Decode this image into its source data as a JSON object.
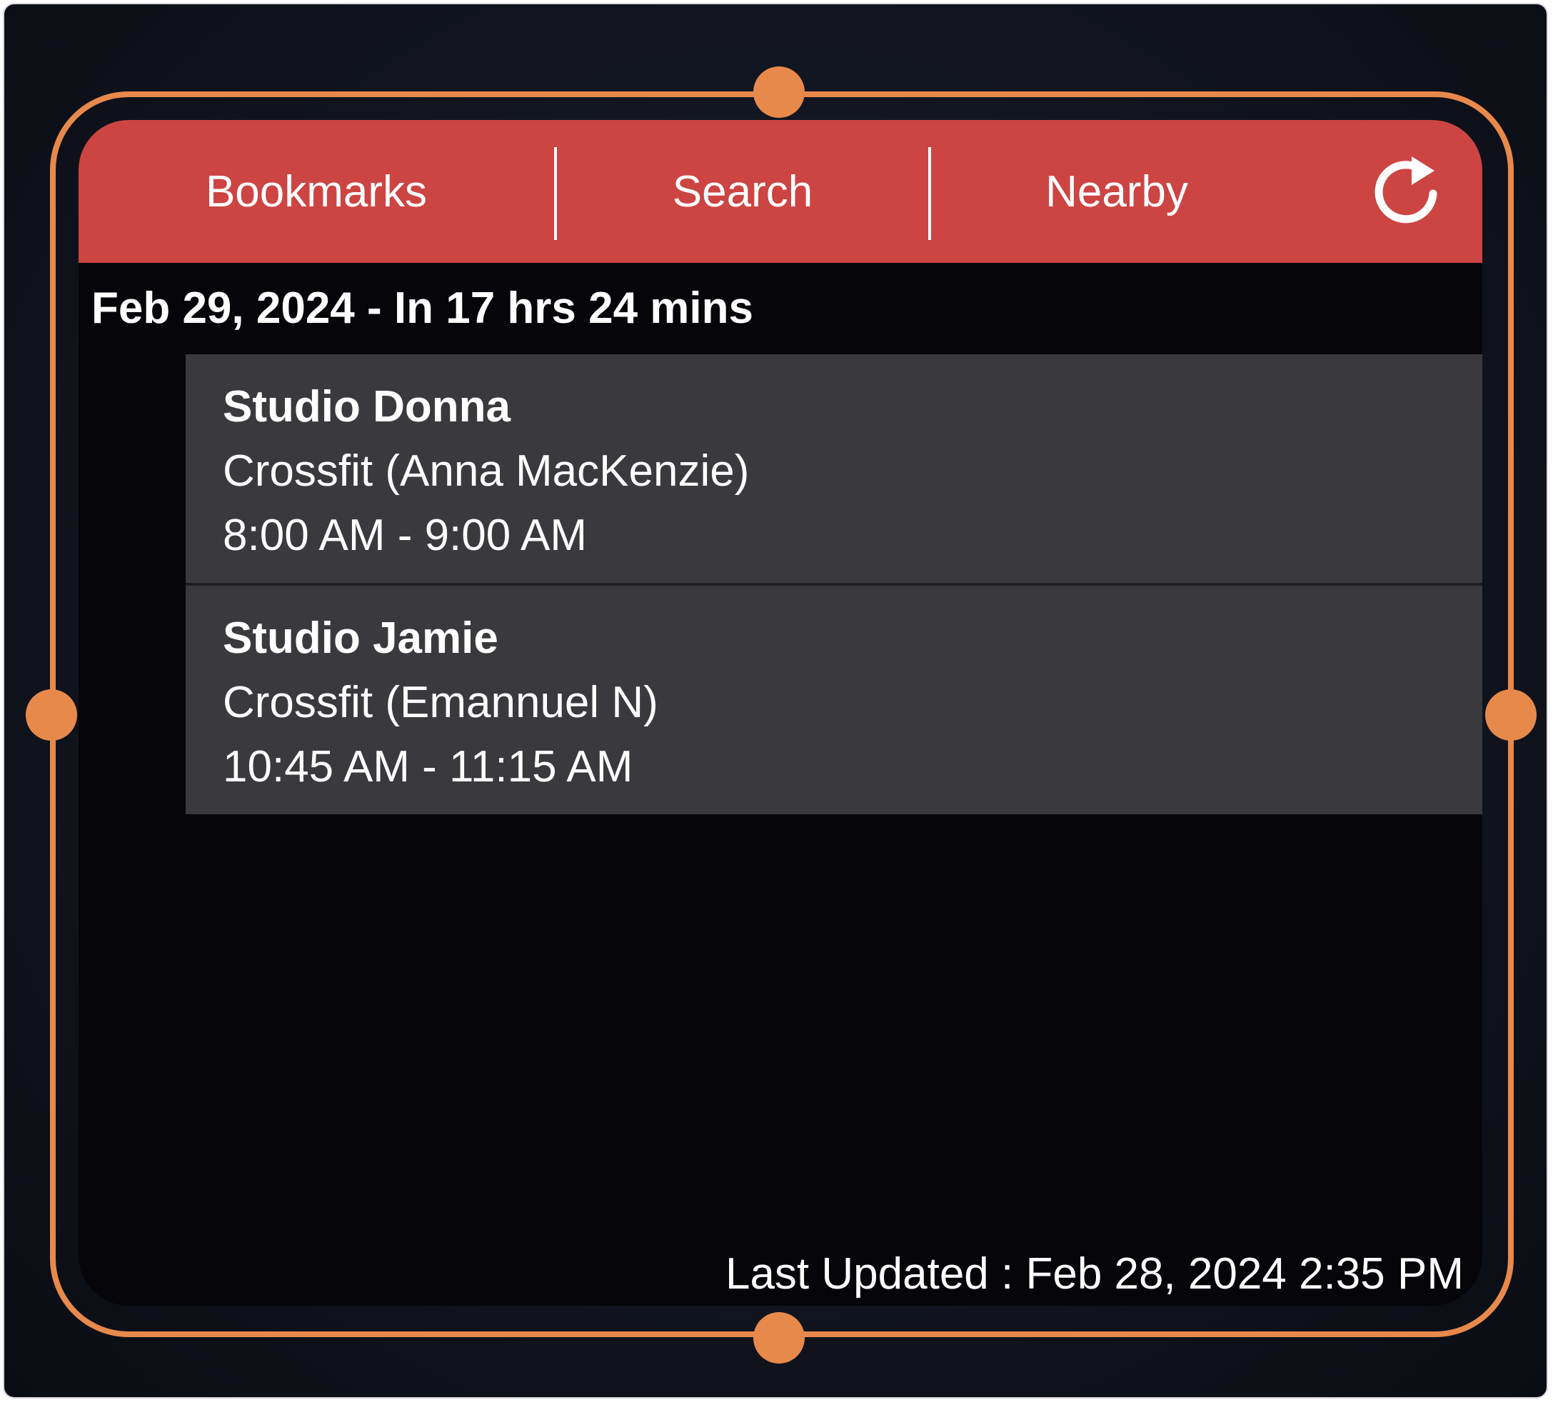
{
  "tabs": [
    {
      "label": "Bookmarks"
    },
    {
      "label": "Search"
    },
    {
      "label": "Nearby"
    }
  ],
  "icons": {
    "refresh": "refresh-icon"
  },
  "colors": {
    "tab_bar": "#cc4543",
    "frame": "#e8894c",
    "item_bg": "#3a3a3e",
    "widget_bg": "#06060a"
  },
  "date_header": "Feb 29, 2024 - In 17 hrs 24 mins",
  "classes": [
    {
      "studio": "Studio Donna",
      "class": "Crossfit (Anna MacKenzie)",
      "time": "8:00 AM - 9:00 AM"
    },
    {
      "studio": "Studio Jamie",
      "class": "Crossfit (Emannuel N)",
      "time": "10:45 AM - 11:15 AM"
    }
  ],
  "footer": {
    "last_updated": "Last Updated : Feb 28, 2024 2:35 PM"
  }
}
